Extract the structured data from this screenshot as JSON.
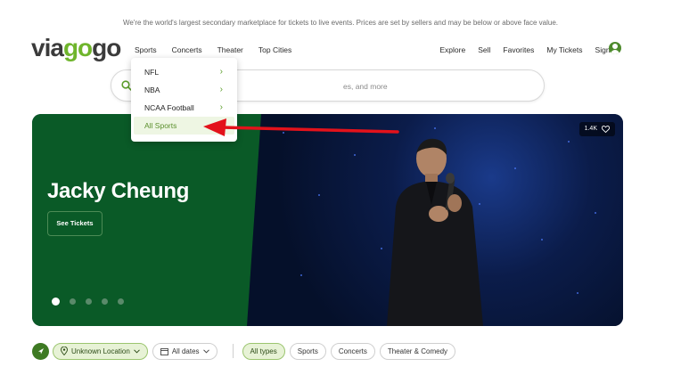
{
  "disclaimer": "We're the world's largest secondary marketplace for tickets to live events. Prices are set by sellers and may be below or above face value.",
  "logo": {
    "part1": "via",
    "part2": "go",
    "part3": "go"
  },
  "nav": {
    "left": [
      "Sports",
      "Concerts",
      "Theater",
      "Top Cities"
    ],
    "right": [
      "Explore",
      "Sell",
      "Favorites",
      "My Tickets",
      "Sign In"
    ]
  },
  "search": {
    "placeholder": "",
    "tail_text": "es, and more"
  },
  "dropdown": {
    "items": [
      {
        "label": "NFL",
        "chevron": "›"
      },
      {
        "label": "NBA",
        "chevron": "›"
      },
      {
        "label": "NCAA Football",
        "chevron": "›"
      },
      {
        "label": "All Sports"
      }
    ]
  },
  "hero": {
    "title": "Jacky Cheung",
    "button": "See Tickets",
    "favorites_count": "1.4K",
    "slide_count": 5,
    "active_slide": 1
  },
  "filters": {
    "location": "Unknown Location",
    "dates": "All dates",
    "types": [
      "All types",
      "Sports",
      "Concerts",
      "Theater & Comedy"
    ],
    "active_type": "All types"
  },
  "colors": {
    "brand_green": "#6fb52c",
    "hero_green": "#0a5a27",
    "arrow_red": "#e3121b"
  }
}
